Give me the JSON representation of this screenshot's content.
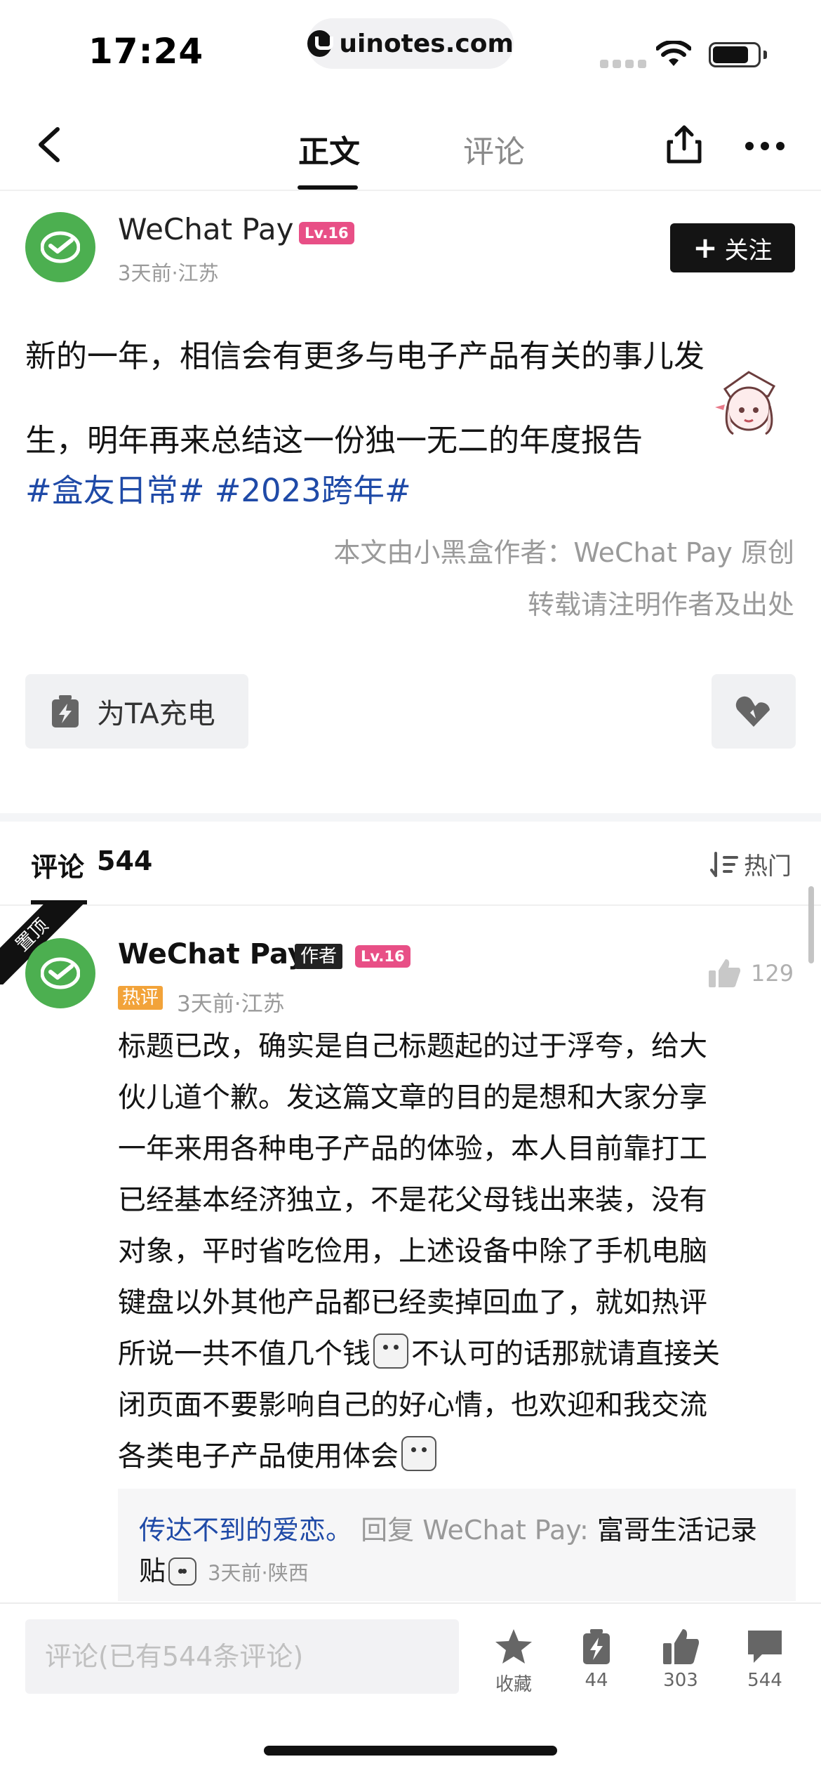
{
  "status_bar": {
    "time": "17:24",
    "url": "uinotes.com"
  },
  "nav": {
    "tab_main": "正文",
    "tab_comments": "评论"
  },
  "author": {
    "name": "WeChat Pay",
    "level": "Lv.16",
    "meta": "3天前·江苏",
    "follow_label": "关注"
  },
  "post": {
    "lines": [
      "新的一年，相信会有更多与电子产品有关的事儿发",
      "生，明年再来总结这一份独一无二的年度报告"
    ],
    "hashtags": "#盒友日常# #2023跨年#",
    "copyright_1": "本文由小黑盒作者：WeChat Pay 原创",
    "copyright_2": "转载请注明作者及出处",
    "charge_label": "为TA充电"
  },
  "comments_header": {
    "title": "评论",
    "count": "544",
    "sort_label": "热门"
  },
  "pinned_comment": {
    "pin_label": "置顶",
    "name": "WeChat Pay",
    "author_tag": "作者",
    "level": "Lv.16",
    "hot_tag": "热评",
    "meta": "3天前·江苏",
    "likes": "129",
    "lines": [
      "标题已改，确实是自己标题起的过于浮夸，给大",
      "伙儿道个歉。发这篇文章的目的是想和大家分享",
      "一年来用各种电子产品的体验，本人目前靠打工",
      "已经基本经济独立，不是花父母钱出来装，没有",
      "对象，平时省吃俭用，上述设备中除了手机电脑",
      "键盘以外其他产品都已经卖掉回血了，就如热评"
    ],
    "line7_a": "所说一共不值几个钱",
    "line7_b": "不认可的话那就请直接关",
    "line8": "闭页面不要影响自己的好心情，也欢迎和我交流",
    "line9": "各类电子产品使用体会",
    "reply": {
      "user": "传达不到的爱恋。",
      "label": "回复 WeChat Pay:",
      "content_1": "富哥生活记录",
      "content_2": "贴",
      "meta": "3天前·陕西"
    }
  },
  "bottom_bar": {
    "input_placeholder": "评论(已有544条评论)",
    "favorite_label": "收藏",
    "charge_count": "44",
    "like_count": "303",
    "comment_count": "544"
  }
}
